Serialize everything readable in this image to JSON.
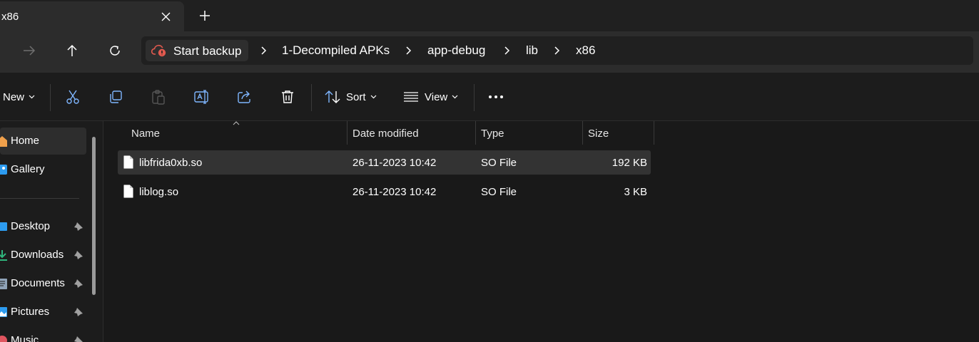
{
  "tab": {
    "title": "x86"
  },
  "address": {
    "backup_label": "Start backup",
    "crumbs": [
      "1-Decompiled APKs",
      "app-debug",
      "lib",
      "x86"
    ]
  },
  "toolbar": {
    "new_label": "New",
    "sort_label": "Sort",
    "view_label": "View"
  },
  "sidebar": {
    "items": [
      {
        "label": "Home",
        "icon": "home-icon",
        "selected": true
      },
      {
        "label": "Gallery",
        "icon": "gallery-icon"
      },
      {
        "label": "Desktop",
        "icon": "desktop-icon",
        "pinned": true
      },
      {
        "label": "Downloads",
        "icon": "downloads-icon",
        "pinned": true
      },
      {
        "label": "Documents",
        "icon": "documents-icon",
        "pinned": true
      },
      {
        "label": "Pictures",
        "icon": "pictures-icon",
        "pinned": true
      },
      {
        "label": "Music",
        "icon": "music-icon",
        "pinned": true
      }
    ]
  },
  "columns": {
    "name": "Name",
    "date": "Date modified",
    "type": "Type",
    "size": "Size"
  },
  "files": [
    {
      "name": "libfrida0xb.so",
      "date": "26-11-2023 10:42",
      "type": "SO File",
      "size": "192 KB",
      "selected": true
    },
    {
      "name": "liblog.so",
      "date": "26-11-2023 10:42",
      "type": "SO File",
      "size": "3 KB"
    }
  ],
  "colors": {
    "accent_cloud": "#e35a4f",
    "folder_blue": "#2d9cf0",
    "download_green": "#2fb67d",
    "music_red": "#e0555f"
  }
}
